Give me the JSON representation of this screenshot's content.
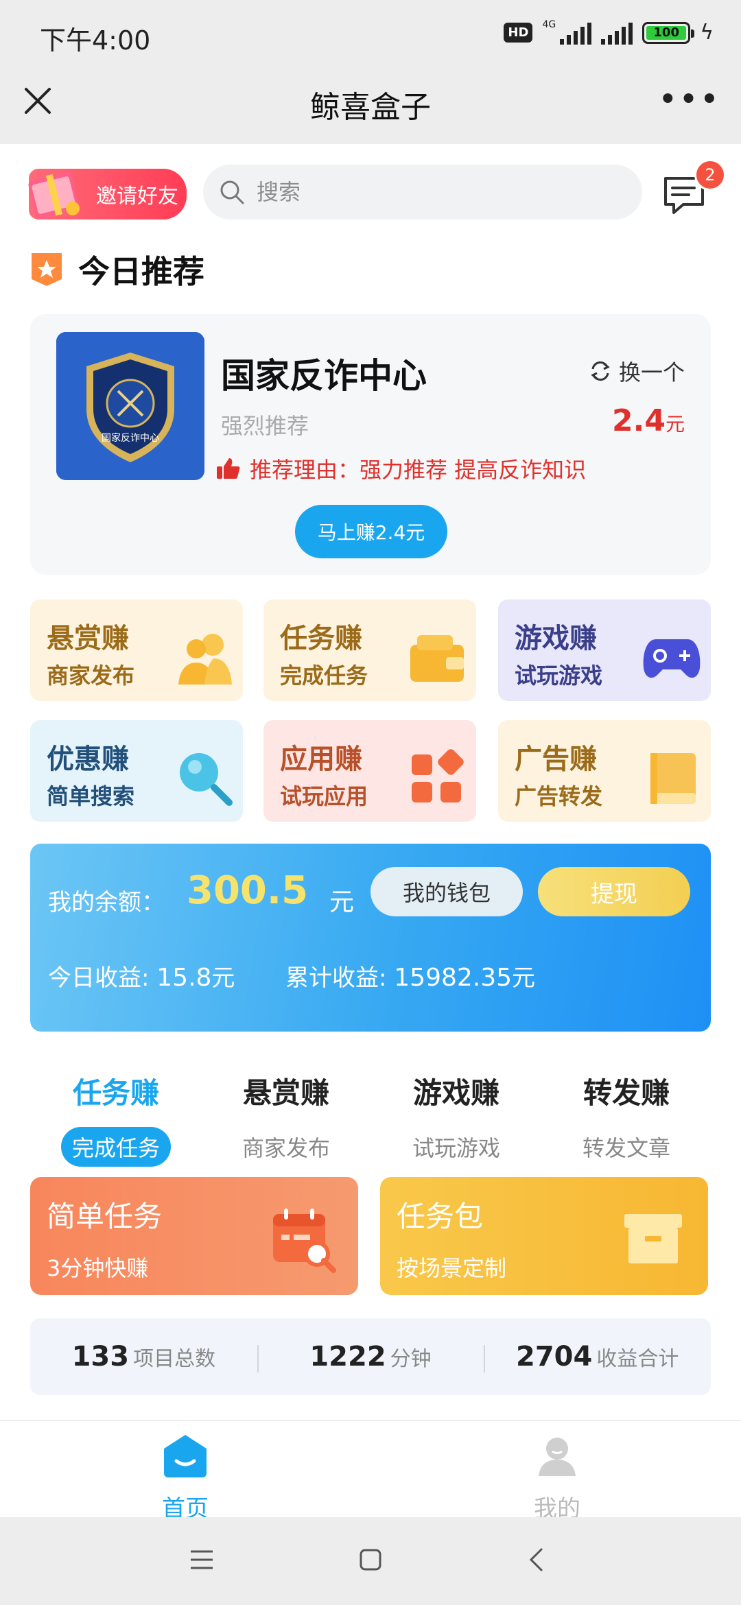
{
  "status_bar": {
    "time": "下午4:00",
    "hd": "HD",
    "network": "4G",
    "battery": "100"
  },
  "titlebar": {
    "title": "鲸喜盒子",
    "more": "•••"
  },
  "top": {
    "invite_label": "邀请好友",
    "search_placeholder": "搜索",
    "message_badge": "2"
  },
  "recommend": {
    "heading": "今日推荐",
    "name": "国家反诈中心",
    "logo_text": "国家反诈中心",
    "swap_label": "换一个",
    "subtitle": "强烈推荐",
    "price": "2.4",
    "price_unit": "元",
    "reason": "推荐理由：强力推荐 提高反诈知识",
    "button": "马上赚2.4元"
  },
  "grid": [
    {
      "title": "悬赏赚",
      "sub": "商家发布",
      "color": "#9b6b1a",
      "bg": "#fdf3df",
      "icon": "people-icon"
    },
    {
      "title": "任务赚",
      "sub": "完成任务",
      "color": "#9b6b1a",
      "bg": "#fdf3df",
      "icon": "wallet-icon"
    },
    {
      "title": "游戏赚",
      "sub": "试玩游戏",
      "color": "#3b3f8a",
      "bg": "#e9e8fb",
      "icon": "gamepad-icon"
    },
    {
      "title": "优惠赚",
      "sub": "简单搜索",
      "color": "#22507a",
      "bg": "#e5f4fb",
      "icon": "search-icon"
    },
    {
      "title": "应用赚",
      "sub": "试玩应用",
      "color": "#b8502a",
      "bg": "#fde6e3",
      "icon": "apps-icon"
    },
    {
      "title": "广告赚",
      "sub": "广告转发",
      "color": "#9b6b1a",
      "bg": "#fdf3df",
      "icon": "book-icon"
    }
  ],
  "balance": {
    "label": "我的余额：",
    "amount": "300.5",
    "unit": "元",
    "wallet_button": "我的钱包",
    "withdraw_button": "提现",
    "today_label": "今日收益: ",
    "today_value": "15.8",
    "total_label": "累计收益: ",
    "total_value": "15982.35"
  },
  "tabs": [
    {
      "title": "任务赚",
      "sub": "完成任务"
    },
    {
      "title": "悬赏赚",
      "sub": "商家发布"
    },
    {
      "title": "游戏赚",
      "sub": "试玩游戏"
    },
    {
      "title": "转发赚",
      "sub": "转发文章"
    }
  ],
  "tasks": [
    {
      "title": "简单任务",
      "sub": "3分钟快赚"
    },
    {
      "title": "任务包",
      "sub": "按场景定制"
    }
  ],
  "stats": [
    {
      "value": "133",
      "label": "项目总数"
    },
    {
      "value": "1222",
      "label": "分钟"
    },
    {
      "value": "2704",
      "label": "收益合计"
    }
  ],
  "bottom_nav": [
    {
      "label": "首页",
      "active": true
    },
    {
      "label": "我的",
      "active": false
    }
  ],
  "colors": {
    "accent": "#1aa6ef",
    "price_red": "#e0302c",
    "balance_yellow": "#f6e36b"
  }
}
